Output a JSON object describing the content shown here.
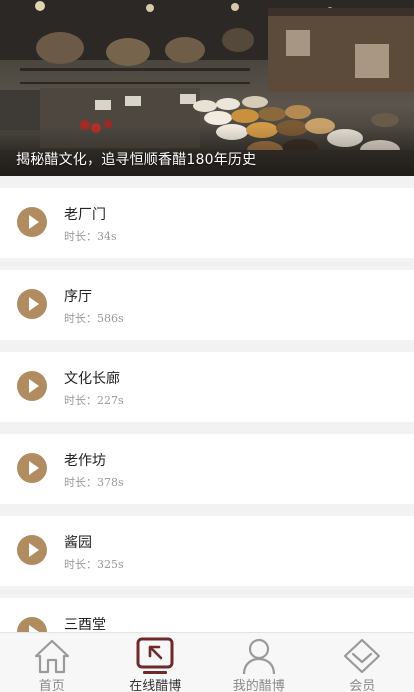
{
  "banner": {
    "caption": "揭秘醋文化，追寻恒顺香醋180年历史"
  },
  "items": [
    {
      "title": "老厂门",
      "duration": "时长：34s"
    },
    {
      "title": "序厅",
      "duration": "时长：586s"
    },
    {
      "title": "文化长廊",
      "duration": "时长：227s"
    },
    {
      "title": "老作坊",
      "duration": "时长：378s"
    },
    {
      "title": "酱园",
      "duration": "时长：325s"
    },
    {
      "title": "三酉堂",
      "duration": ""
    }
  ],
  "tabbar": {
    "tabs": [
      {
        "label": "首页",
        "icon": "home-icon",
        "active": false
      },
      {
        "label": "在线醋博",
        "icon": "online-museum-icon",
        "active": true
      },
      {
        "label": "我的醋博",
        "icon": "user-icon",
        "active": false
      },
      {
        "label": "会员",
        "icon": "vip-diamond-icon",
        "active": false
      }
    ]
  },
  "colors": {
    "accent": "#b18c60",
    "active_icon": "#6e2a2a",
    "inactive_icon": "#9a9a9a"
  }
}
